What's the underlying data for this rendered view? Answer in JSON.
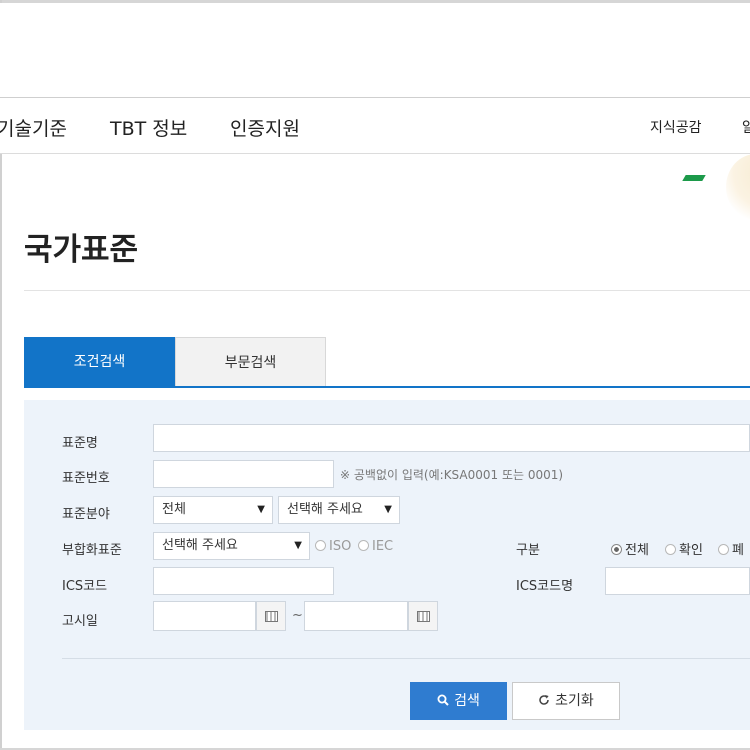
{
  "nav": {
    "items": [
      "기술기준",
      "TBT 정보",
      "인증지원"
    ],
    "util": [
      "지식공감",
      "알"
    ]
  },
  "page": {
    "title": "국가표준"
  },
  "tabs": [
    {
      "label": "조건검색",
      "active": true
    },
    {
      "label": "부문검색",
      "active": false
    }
  ],
  "form": {
    "std_name_label": "표준명",
    "std_no_label": "표준번호",
    "std_no_hint": "※ 공백없이 입력(예:KSA0001 또는 0001)",
    "field_label": "표준분야",
    "field_select": "전체",
    "field_sub_select": "선택해 주세요",
    "adopted_label": "부합화표준",
    "adopted_select": "선택해 주세요",
    "adopted_iso": "ISO",
    "adopted_iec": "IEC",
    "class_label": "구분",
    "class_options": [
      "전체",
      "확인",
      "폐"
    ],
    "ics_code_label": "ICS코드",
    "ics_name_label": "ICS코드명",
    "date_label": "고시일",
    "date_sep": "~"
  },
  "actions": {
    "search": "검색",
    "reset": "초기화"
  },
  "colors": {
    "accent": "#1274c8",
    "panel_bg": "#edf3fa",
    "deco_green": "#1c9a4a"
  }
}
